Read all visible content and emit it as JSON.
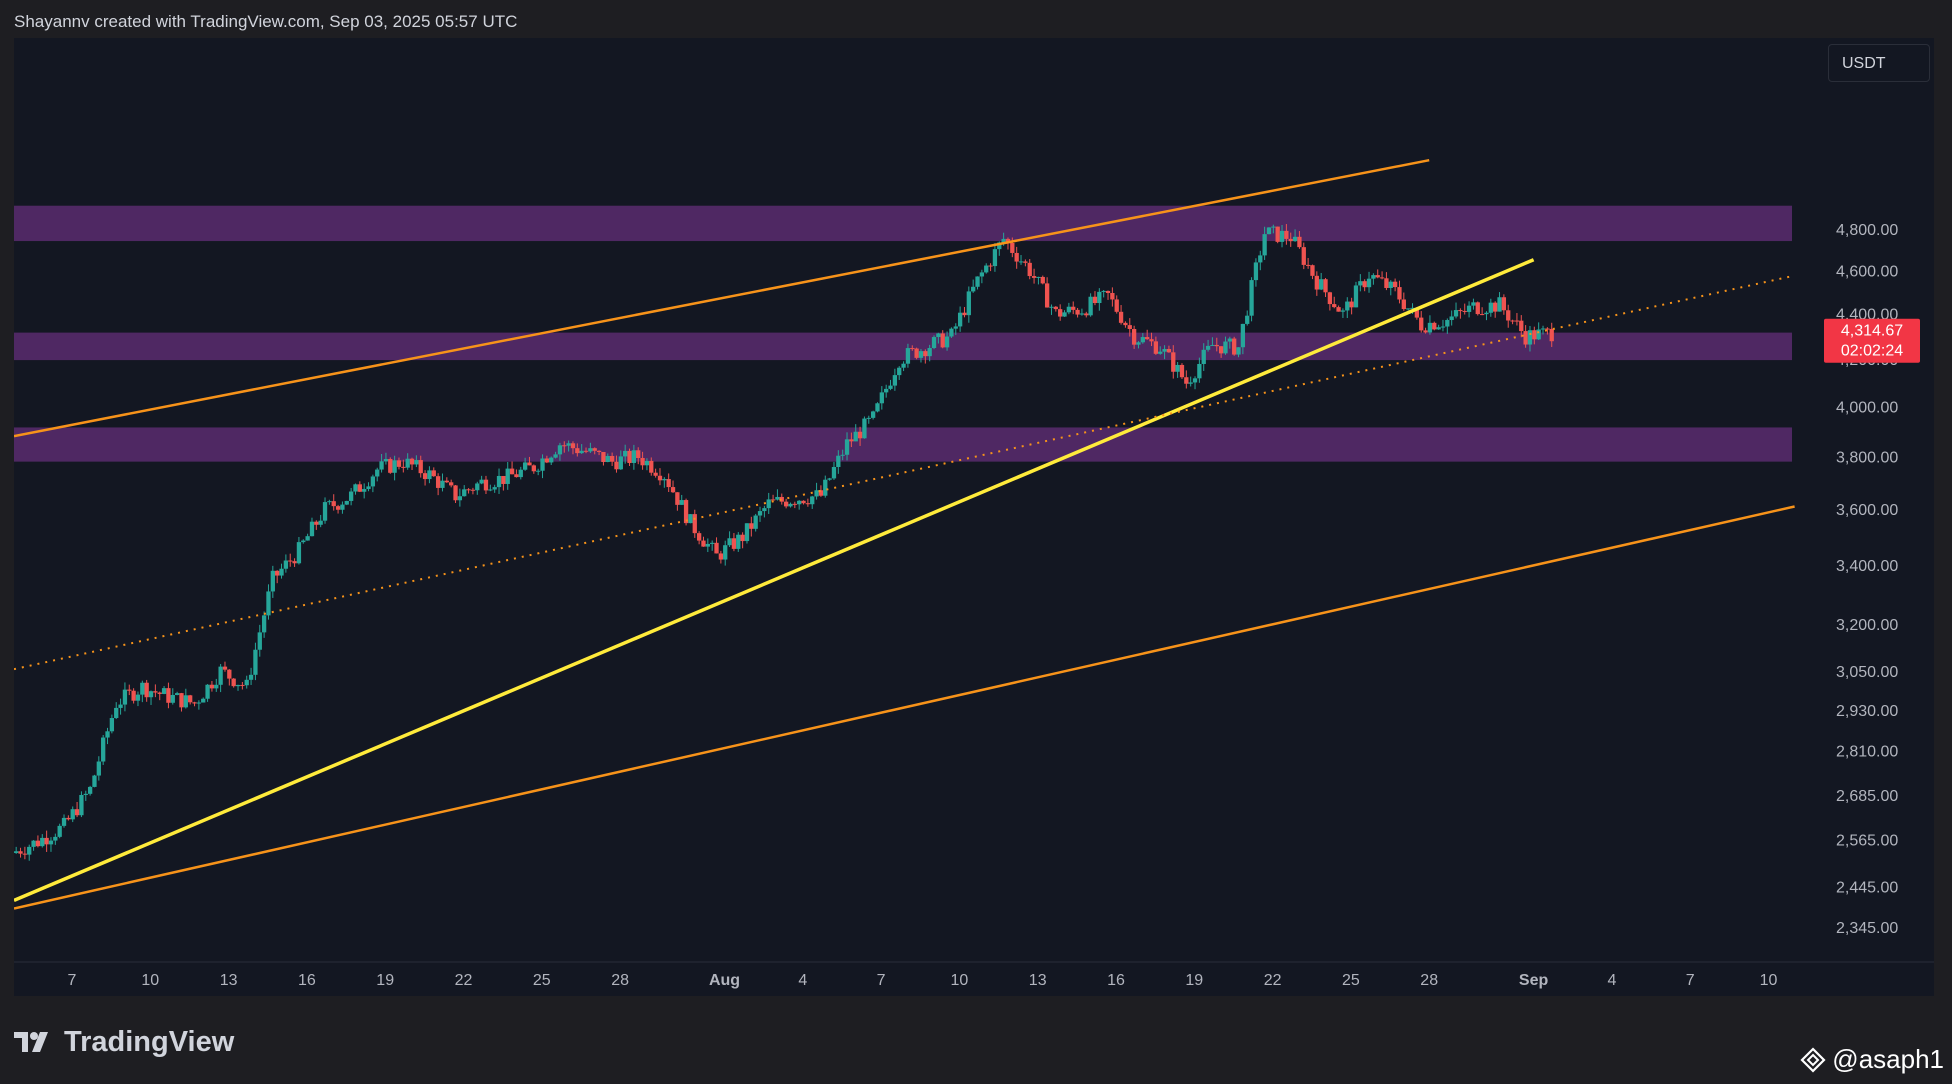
{
  "header": {
    "credit": "Shayannv created with TradingView.com, Sep 03, 2025 05:57 UTC"
  },
  "currency": "USDT",
  "branding": {
    "logo_text": "TradingView",
    "logo_icon": "tradingview-logo-icon",
    "watermark": "@asaph1",
    "watermark_icon": "binance-diamond-icon"
  },
  "colors": {
    "background": "#131722",
    "up": "#26a69a",
    "down": "#ef5350",
    "zone": "#5b2c6f",
    "channel": "#f7931a",
    "trendline": "#ffeb3b",
    "price_tag": "#f23645"
  },
  "chart_data": {
    "type": "candlestick",
    "title": "",
    "xlabel": "",
    "ylabel": "",
    "ylim": [
      2300,
      5150
    ],
    "y_ticks": [
      "4,800.00",
      "4,600.00",
      "4,400.00",
      "4,200.00",
      "4,000.00",
      "3,800.00",
      "3,600.00",
      "3,400.00",
      "3,200.00",
      "3,050.00",
      "2,930.00",
      "2,810.00",
      "2,685.00",
      "2,565.00",
      "2,445.00",
      "2,345.00"
    ],
    "x_ticks": [
      "7",
      "10",
      "13",
      "16",
      "19",
      "22",
      "25",
      "28",
      "Aug",
      "4",
      "7",
      "10",
      "13",
      "16",
      "19",
      "22",
      "25",
      "28",
      "Sep",
      "4",
      "7",
      "10"
    ],
    "x_ticks_bold": [
      "Aug",
      "Sep"
    ],
    "current_price": "4,314.67",
    "countdown": "02:02:24",
    "closes_daily": [
      {
        "date": "Jul 6",
        "close": 2530
      },
      {
        "date": "Jul 7",
        "close": 2560
      },
      {
        "date": "Jul 8",
        "close": 2600
      },
      {
        "date": "Jul 9",
        "close": 2700
      },
      {
        "date": "Jul 10",
        "close": 2950
      },
      {
        "date": "Jul 11",
        "close": 3000
      },
      {
        "date": "Jul 12",
        "close": 2970
      },
      {
        "date": "Jul 13",
        "close": 2950
      },
      {
        "date": "Jul 14",
        "close": 3050
      },
      {
        "date": "Jul 15",
        "close": 3000
      },
      {
        "date": "Jul 16",
        "close": 3350
      },
      {
        "date": "Jul 17",
        "close": 3450
      },
      {
        "date": "Jul 18",
        "close": 3600
      },
      {
        "date": "Jul 19",
        "close": 3650
      },
      {
        "date": "Jul 20",
        "close": 3750
      },
      {
        "date": "Jul 21",
        "close": 3780
      },
      {
        "date": "Jul 22",
        "close": 3730
      },
      {
        "date": "Jul 23",
        "close": 3650
      },
      {
        "date": "Jul 24",
        "close": 3700
      },
      {
        "date": "Jul 25",
        "close": 3720
      },
      {
        "date": "Jul 26",
        "close": 3760
      },
      {
        "date": "Jul 27",
        "close": 3850
      },
      {
        "date": "Jul 28",
        "close": 3820
      },
      {
        "date": "Jul 29",
        "close": 3780
      },
      {
        "date": "Jul 30",
        "close": 3800
      },
      {
        "date": "Jul 31",
        "close": 3730
      },
      {
        "date": "Aug 1",
        "close": 3550
      },
      {
        "date": "Aug 2",
        "close": 3430
      },
      {
        "date": "Aug 3",
        "close": 3500
      },
      {
        "date": "Aug 4",
        "close": 3620
      },
      {
        "date": "Aug 5",
        "close": 3640
      },
      {
        "date": "Aug 6",
        "close": 3650
      },
      {
        "date": "Aug 7",
        "close": 3850
      },
      {
        "date": "Aug 8",
        "close": 3950
      },
      {
        "date": "Aug 9",
        "close": 4200
      },
      {
        "date": "Aug 10",
        "close": 4250
      },
      {
        "date": "Aug 11",
        "close": 4300
      },
      {
        "date": "Aug 12",
        "close": 4550
      },
      {
        "date": "Aug 13",
        "close": 4750
      },
      {
        "date": "Aug 14",
        "close": 4600
      },
      {
        "date": "Aug 15",
        "close": 4400
      },
      {
        "date": "Aug 16",
        "close": 4420
      },
      {
        "date": "Aug 17",
        "close": 4480
      },
      {
        "date": "Aug 18",
        "close": 4300
      },
      {
        "date": "Aug 19",
        "close": 4250
      },
      {
        "date": "Aug 20",
        "close": 4100
      },
      {
        "date": "Aug 21",
        "close": 4260
      },
      {
        "date": "Aug 22",
        "close": 4250
      },
      {
        "date": "Aug 23",
        "close": 4780
      },
      {
        "date": "Aug 24",
        "close": 4760
      },
      {
        "date": "Aug 25",
        "close": 4550
      },
      {
        "date": "Aug 26",
        "close": 4400
      },
      {
        "date": "Aug 27",
        "close": 4580
      },
      {
        "date": "Aug 28",
        "close": 4500
      },
      {
        "date": "Aug 29",
        "close": 4350
      },
      {
        "date": "Aug 30",
        "close": 4370
      },
      {
        "date": "Aug 31",
        "close": 4430
      },
      {
        "date": "Sep 1",
        "close": 4440
      },
      {
        "date": "Sep 2",
        "close": 4300
      },
      {
        "date": "Sep 3",
        "close": 4314.67
      }
    ],
    "zones": [
      {
        "low": 4740,
        "high": 4915
      },
      {
        "low": 4195,
        "high": 4315
      },
      {
        "low": 3780,
        "high": 3915
      }
    ],
    "channel_lines": [
      {
        "start": {
          "date": "Jul 6",
          "price": 3880
        },
        "end": {
          "date": "Aug 28",
          "price": 5150
        }
      },
      {
        "start": {
          "date": "Jul 6",
          "price": 2390
        },
        "end": {
          "date": "Sep 11",
          "price": 3610
        }
      }
    ],
    "trendline": {
      "start": {
        "date": "Jul 6",
        "price": 2410
      },
      "end": {
        "date": "Sep 1",
        "price": 4650
      }
    },
    "dotted_midline": {
      "start": {
        "date": "Jul 6",
        "price": 3055
      },
      "end": {
        "date": "Sep 11",
        "price": 4575
      }
    }
  }
}
